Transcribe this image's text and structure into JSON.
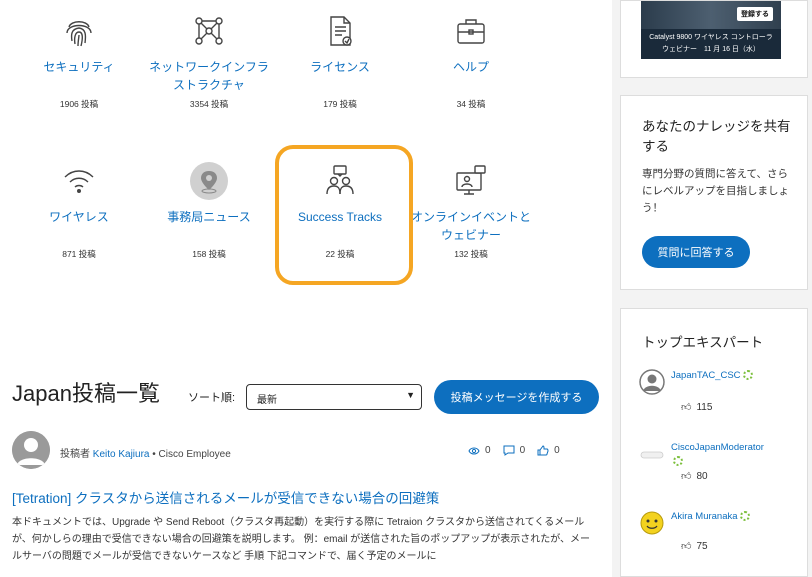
{
  "categories": [
    {
      "icon": "fingerprint-icon",
      "name": "セキュリティ",
      "count": "1906 投稿"
    },
    {
      "icon": "network-icon",
      "name": "ネットワークインフラストラクチャ",
      "count": "3354 投稿"
    },
    {
      "icon": "license-document-icon",
      "name": "ライセンス",
      "count": "179 投稿"
    },
    {
      "icon": "briefcase-icon",
      "name": "ヘルプ",
      "count": "34 投稿"
    },
    {
      "icon": "wifi-icon",
      "name": "ワイヤレス",
      "count": "871 投稿"
    },
    {
      "icon": "location-pin-icon",
      "name": "事務局ニュース",
      "count": "158 投稿"
    },
    {
      "icon": "people-chat-icon",
      "name": "Success Tracks",
      "count": "22 投稿"
    },
    {
      "icon": "online-event-icon",
      "name": "オンラインイベントとウェビナー",
      "count": "132 投稿"
    }
  ],
  "list": {
    "title": "Japan投稿一覧",
    "sort_label": "ソート順:",
    "sort_value": "最新",
    "create_button": "投稿メッセージを作成する"
  },
  "post": {
    "by_prefix": "投稿者",
    "author": "Keito Kajiura",
    "role": "• Cisco Employee",
    "views": "0",
    "comments": "0",
    "likes": "0",
    "title": "[Tetration] クラスタから送信されるメールが受信できない場合の回避策",
    "body": "本ドキュメントでは、Upgrade や Send Reboot（クラスタ再起動）を実行する際に Tetraion クラスタから送信されてくるメールが、何かしらの理由で受信できない場合の回避策を説明します。 例：email が送信された旨のポップアップが表示されたが、メールサーバの問題でメールが受信できないケースなど 手順 下記コマンドで、届く予定のメールに"
  },
  "sidebar": {
    "banner": {
      "register": "登録する",
      "line1": "Catalyst 9800 ワイヤレス コントローラ",
      "line2": "ウェビナー　11 月 16 日（水）"
    },
    "knowledge": {
      "title": "あなたのナレッジを共有する",
      "text": "専門分野の質問に答えて、さらにレベルアップを目指しましょう！",
      "button": "質問に回答する"
    },
    "experts": {
      "title": "トップエキスパート",
      "items": [
        {
          "name": "JapanTAC_CSC",
          "likes": "115"
        },
        {
          "name": "CiscoJapanModerator",
          "likes": "80"
        },
        {
          "name": "Akira Muranaka",
          "likes": "75"
        }
      ]
    }
  },
  "colors": {
    "accent": "#0d6fbf",
    "highlight": "#f5a623"
  }
}
